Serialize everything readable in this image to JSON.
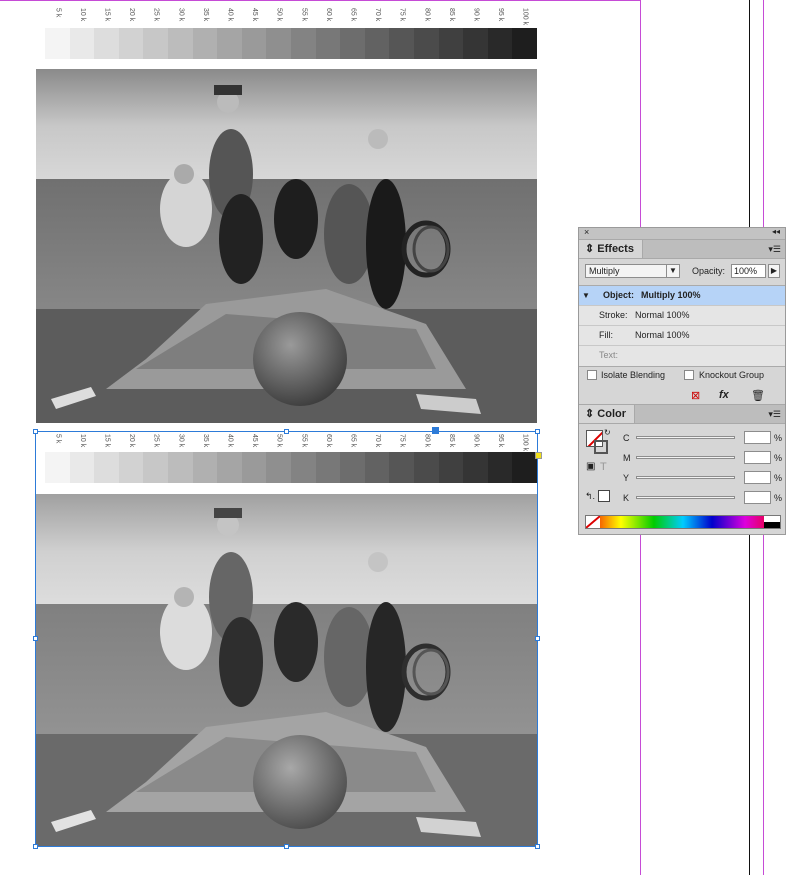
{
  "ruler": {
    "tick_labels": [
      "5 k",
      "10 k",
      "15 k",
      "20 k",
      "25 k",
      "30 k",
      "35 k",
      "40 k",
      "45 k",
      "50 k",
      "55 k",
      "60 k",
      "65 k",
      "70 k",
      "75 k",
      "80 k",
      "85 k",
      "90 k",
      "95 k",
      "100 k"
    ]
  },
  "gray_steps_percent": [
    5,
    10,
    15,
    20,
    25,
    30,
    35,
    40,
    45,
    50,
    55,
    60,
    65,
    70,
    75,
    80,
    85,
    90,
    95,
    100
  ],
  "effects_panel": {
    "title": "Effects",
    "blend_mode": "Multiply",
    "opacity_label": "Opacity:",
    "opacity_value": "100%",
    "rows": [
      {
        "label": "Object:",
        "value": "Multiply 100%"
      },
      {
        "label": "Stroke:",
        "value": "Normal 100%"
      },
      {
        "label": "Fill:",
        "value": "Normal 100%"
      },
      {
        "label": "Text:",
        "value": ""
      }
    ],
    "isolate_blending": "Isolate Blending",
    "knockout_group": "Knockout Group",
    "fx_label": "fx"
  },
  "color_panel": {
    "title": "Color",
    "channels": [
      {
        "label": "C",
        "value": ""
      },
      {
        "label": "M",
        "value": ""
      },
      {
        "label": "Y",
        "value": ""
      },
      {
        "label": "K",
        "value": ""
      }
    ],
    "unit": "%"
  },
  "colors": {
    "guide_magenta": "#c64bd6",
    "selection_blue": "#2d7bd8",
    "panel_bg": "#d6d6d6",
    "highlight": "#b6d3f7"
  }
}
